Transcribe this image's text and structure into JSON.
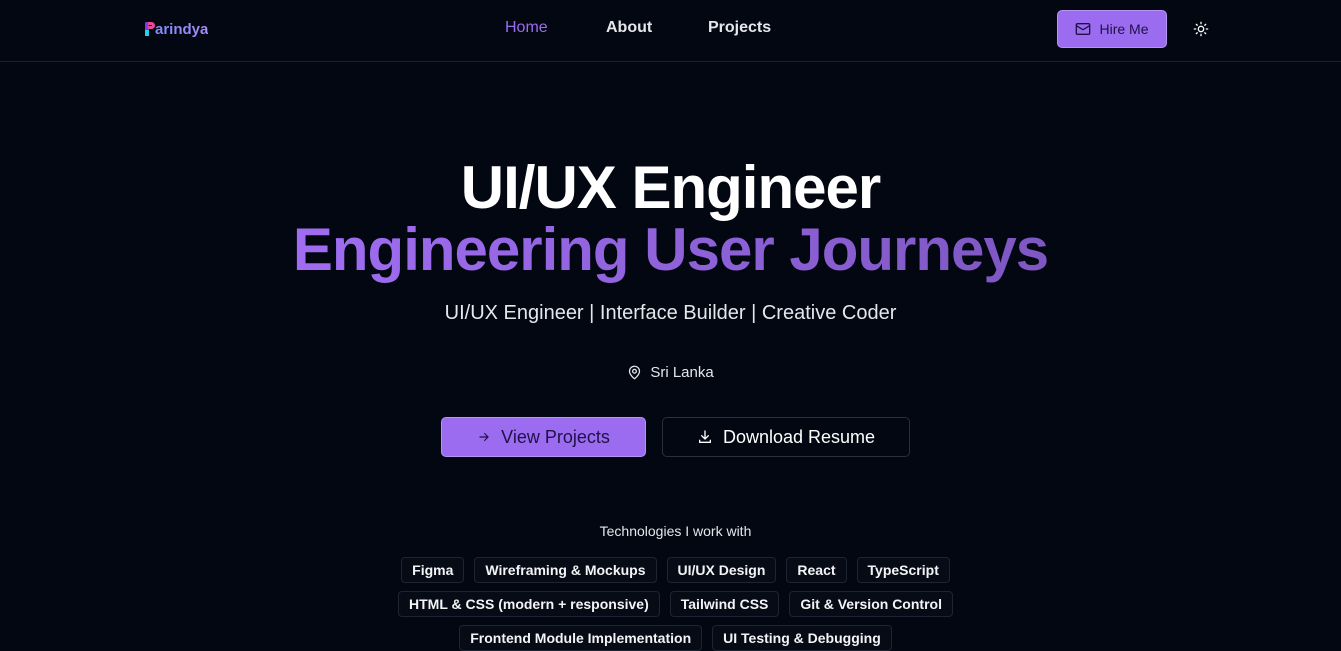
{
  "brand": {
    "name": "arindya",
    "accent": "#9b6cf0"
  },
  "nav": {
    "items": [
      {
        "label": "Home",
        "active": true
      },
      {
        "label": "About",
        "active": false
      },
      {
        "label": "Projects",
        "active": false
      }
    ],
    "hire_label": "Hire Me",
    "hire_icon": "mail-icon",
    "theme_icon": "sun-icon"
  },
  "hero": {
    "title": "UI/UX Engineer",
    "subtitle": "Engineering User Journeys",
    "tagline": "UI/UX Engineer | Interface Builder | Creative Coder",
    "location": "Sri Lanka",
    "location_icon": "map-pin-icon",
    "primary_cta": "View Projects",
    "primary_icon": "arrow-right-icon",
    "secondary_cta": "Download Resume",
    "secondary_icon": "download-icon"
  },
  "technologies": {
    "heading": "Technologies I work with",
    "rows": [
      [
        "Figma",
        "Wireframing & Mockups",
        "UI/UX Design",
        "React",
        "TypeScript"
      ],
      [
        "HTML & CSS (modern + responsive)",
        "Tailwind CSS",
        "Git & Version Control"
      ],
      [
        "Frontend Module Implementation",
        "UI Testing & Debugging"
      ]
    ]
  }
}
